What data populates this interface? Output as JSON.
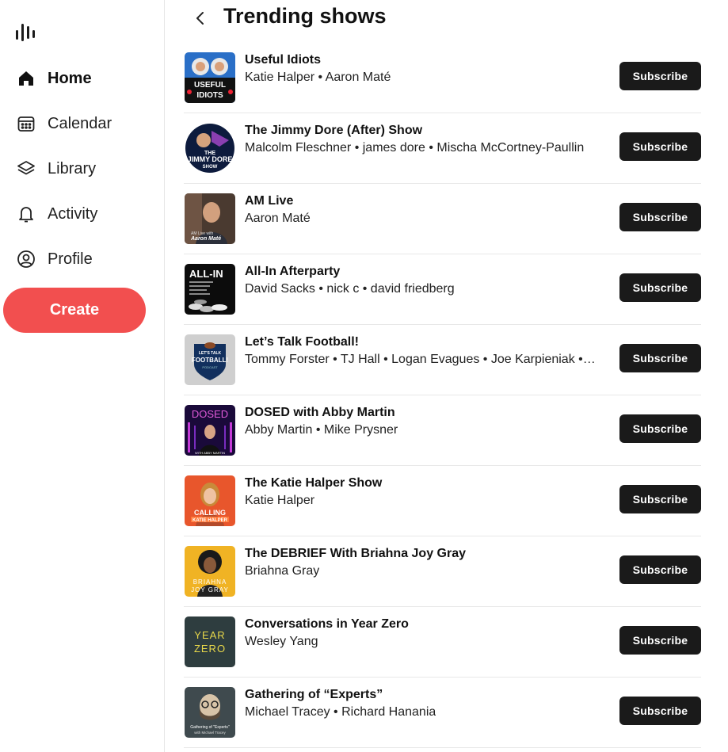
{
  "sidebar": {
    "nav": [
      {
        "label": "Home",
        "icon": "home-icon",
        "active": true
      },
      {
        "label": "Calendar",
        "icon": "calendar-icon",
        "active": false
      },
      {
        "label": "Library",
        "icon": "library-icon",
        "active": false
      },
      {
        "label": "Activity",
        "icon": "bell-icon",
        "active": false
      },
      {
        "label": "Profile",
        "icon": "profile-icon",
        "active": false
      }
    ],
    "create_label": "Create"
  },
  "header": {
    "title": "Trending shows",
    "back_icon": "chevron-left-icon"
  },
  "button_label": "Subscribe",
  "shows": [
    {
      "title": "Useful Idiots",
      "hosts": "Katie Halper • Aaron Maté",
      "art_text": "USEFUL IDIOTS"
    },
    {
      "title": "The Jimmy Dore (After) Show",
      "hosts": "Malcolm Fleschner • james dore • Mischa McCortney-Paullin",
      "art_text": "THE JIMMY DORE SHOW"
    },
    {
      "title": "AM Live",
      "hosts": "Aaron Maté",
      "art_text": "Aaron Maté"
    },
    {
      "title": "All-In Afterparty",
      "hosts": "David Sacks • nick c • david friedberg",
      "art_text": "ALL-IN"
    },
    {
      "title": "Let’s Talk Football!",
      "hosts": "Tommy Forster • TJ Hall • Logan Evagues • Joe Karpieniak • Mike",
      "art_text": "LET'S TALK FOOTBALL!"
    },
    {
      "title": "DOSED with Abby Martin",
      "hosts": "Abby Martin • Mike Prysner",
      "art_text": "DOSED"
    },
    {
      "title": "The Katie Halper Show",
      "hosts": "Katie Halper",
      "art_text": "CALLING KATIE HALPER"
    },
    {
      "title": "The DEBRIEF With Briahna Joy Gray",
      "hosts": "Briahna Gray",
      "art_text": "BRIAHNA JOY GRAY"
    },
    {
      "title": "Conversations in Year Zero",
      "hosts": "Wesley Yang",
      "art_text": "YEAR ZERO"
    },
    {
      "title": "Gathering of “Experts”",
      "hosts": "Michael Tracey • Richard Hanania",
      "art_text": "Gathering of Experts with Michael Tracey"
    }
  ],
  "colors": {
    "accent": "#f24f4f",
    "button": "#1a1a1a"
  }
}
